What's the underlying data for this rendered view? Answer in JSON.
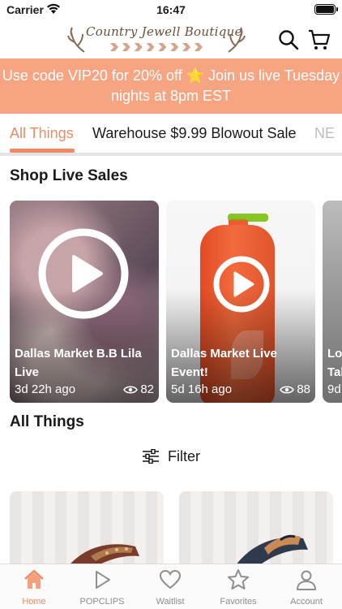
{
  "status_bar": {
    "carrier": "Carrier",
    "time": "16:47"
  },
  "header": {
    "brand": "Country Jewell Boutique"
  },
  "promo": {
    "line1": "Use code VIP20 for 20% off ⭐ Join us live Tuesday",
    "line2": "nights at 8pm EST"
  },
  "tabs": [
    {
      "label": "All Things",
      "active": true
    },
    {
      "label": "Warehouse $9.99 Blowout Sale"
    },
    {
      "label": "NE"
    }
  ],
  "live_sales": {
    "title": "Shop Live Sales",
    "videos": [
      {
        "title": "Dallas Market B.B Lila Live",
        "ago": "3d 22h ago",
        "views": "82"
      },
      {
        "title": "Dallas Market Live Event!",
        "ago": "5d 16h ago",
        "views": "88"
      },
      {
        "title": "Lo Tal",
        "ago": "9d"
      }
    ]
  },
  "all_things": {
    "title": "All Things",
    "filter_label": "Filter"
  },
  "bottom_nav": [
    {
      "label": "Home",
      "icon": "home-icon",
      "active": true
    },
    {
      "label": "POPCLIPS",
      "icon": "play-icon"
    },
    {
      "label": "Waitlist",
      "icon": "heart-icon"
    },
    {
      "label": "Favorites",
      "icon": "star-icon"
    },
    {
      "label": "Account",
      "icon": "person-icon"
    }
  ],
  "colors": {
    "accent": "#f08a63",
    "promo_bg": "#f7a483",
    "inactive": "#8e8e93"
  }
}
